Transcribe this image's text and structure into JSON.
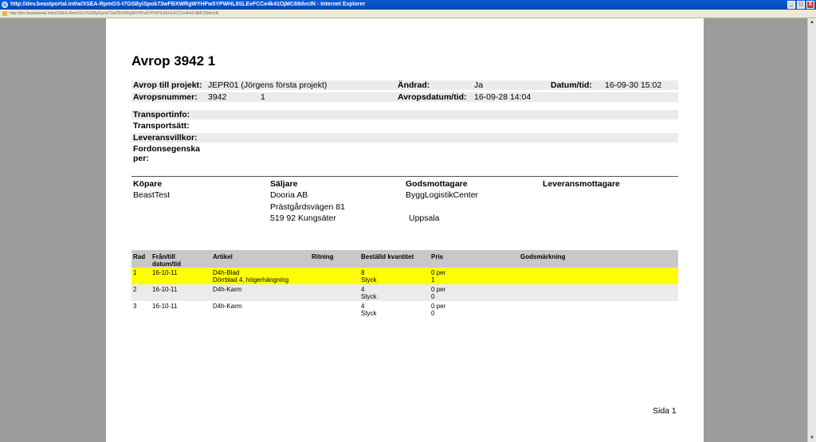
{
  "window": {
    "title": "http://dev.beastportal.int/w/XSEA-RpmGS-t7GSByiSpok73wFBXWRgWYHFw5YPWHL8SLEvFCCe4k41OjMC69dvcIN - Internet Explorer",
    "url": "http://dev.beastportal.int/w/XSEA-RpmGS-t7GSByiSpok73wFBXWRgWYHFw5YPWHL8SLEvFCCe4k41OjMC69dvcIN",
    "minimize": "_",
    "maximize": "□",
    "close": "X"
  },
  "doc": {
    "title": "Avrop 3942 1",
    "header": {
      "avrop_till_projekt_label": "Avrop till projekt:",
      "avrop_till_projekt_value": "JEPR01 (Jörgens första projekt)",
      "andrad_label": "Ändrad:",
      "andrad_value": "Ja",
      "datum_tid_label": "Datum/tid:",
      "datum_tid_value": "16-09-30 15:02",
      "avropsnummer_label": "Avropsnummer:",
      "avropsnummer_value": "3942",
      "avropsnummer_sub": "1",
      "avropsdatum_label": "Avropsdatum/tid:",
      "avropsdatum_value": "16-09-28 14:04",
      "transportinfo_label": "Transportinfo:",
      "transportsatt_label": "Transportsätt:",
      "leveransvillkor_label": "Leveransvillkor:",
      "fordonsegenskaper_label_1": "Fordonsegenska",
      "fordonsegenskaper_label_2": "per:"
    },
    "parties": {
      "kopare_label": "Köpare",
      "kopare_name": "BeastTest",
      "saljare_label": "Säljare",
      "saljare_name": "Dooria AB",
      "saljare_address": "Prästgårdsvägen 81",
      "saljare_city": "519 92 Kungsäter",
      "godsmottagare_label": "Godsmottagare",
      "godsmottagare_name": "ByggLogistikCenter",
      "godsmottagare_city": "Uppsala",
      "leveransmottagare_label": "Leveransmottagare"
    },
    "table": {
      "headers": {
        "rad": "Rad",
        "fran_till_1": "Från/till",
        "fran_till_2": "datum/tid",
        "artikel": "Artikel",
        "ritning": "Ritning",
        "bestalld": "Beställd kvantitet",
        "pris": "Pris",
        "godsmarkning": "Godsmärkning"
      },
      "rows": [
        {
          "rad": "1",
          "datum": "16-10-11",
          "artikel": "D4h-Blad",
          "artikel2": "Dörrblad 4, högerhängning",
          "kvantitet": "8",
          "enhet": "Styck",
          "pris": "0 per",
          "pris2": "1"
        },
        {
          "rad": "2",
          "datum": "16-10-11",
          "artikel": "D4h-Karm",
          "artikel2": "",
          "kvantitet": "4",
          "enhet": "Styck",
          "pris": "0 per",
          "pris2": "0"
        },
        {
          "rad": "3",
          "datum": "16-10-11",
          "artikel": "D4h-Karm",
          "artikel2": "",
          "kvantitet": "4",
          "enhet": "Styck",
          "pris": "0 per",
          "pris2": "0"
        }
      ]
    },
    "page_number": "Sida 1"
  },
  "colors": {
    "selected_row": "#ffff00",
    "shaded_row": "#ebebeb",
    "table_header": "#c8c8c8",
    "background": "#9b9b9b"
  },
  "icons": {
    "window_icon": "internet-explorer-icon",
    "page_icon": "page-icon"
  }
}
